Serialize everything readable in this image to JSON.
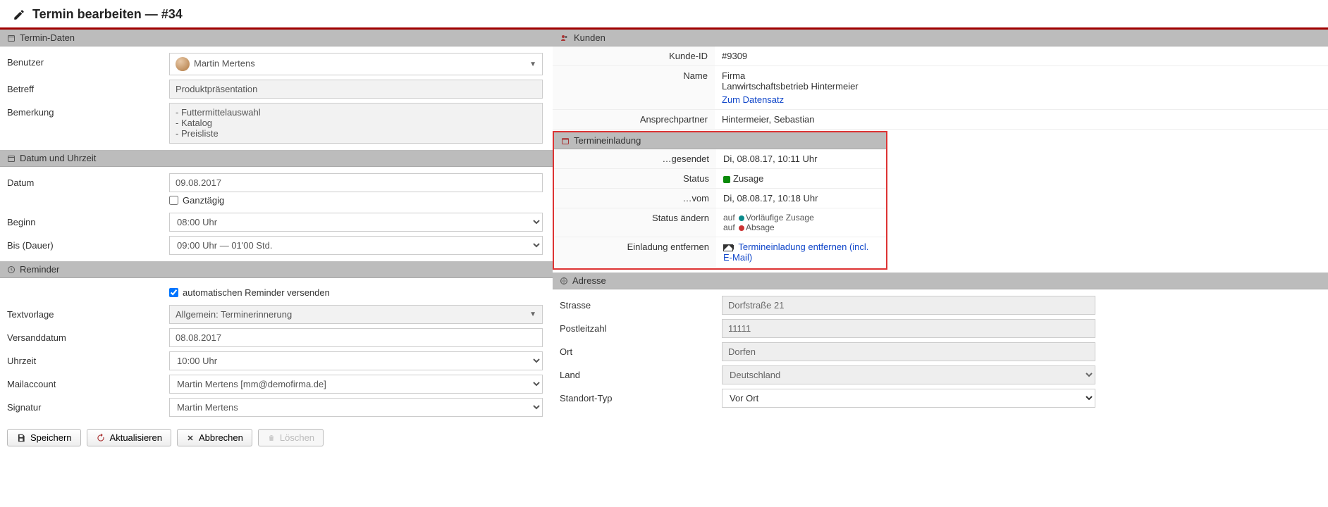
{
  "header": {
    "title": "Termin bearbeiten — #34"
  },
  "sections": {
    "termin_daten": "Termin-Daten",
    "datum_uhrzeit": "Datum und Uhrzeit",
    "reminder": "Reminder",
    "kunden": "Kunden",
    "termineinladung": "Termineinladung",
    "adresse": "Adresse"
  },
  "labels": {
    "benutzer": "Benutzer",
    "betreff": "Betreff",
    "bemerkung": "Bemerkung",
    "datum": "Datum",
    "ganztaegig": "Ganztägig",
    "beginn": "Beginn",
    "bis_dauer": "Bis (Dauer)",
    "auto_reminder": "automatischen Reminder versenden",
    "textvorlage": "Textvorlage",
    "versanddatum": "Versanddatum",
    "uhrzeit": "Uhrzeit",
    "mailaccount": "Mailaccount",
    "signatur": "Signatur",
    "kunde_id": "Kunde-ID",
    "name": "Name",
    "zum_datensatz": "Zum Datensatz",
    "ansprechpartner": "Ansprechpartner",
    "gesendet": "…gesendet",
    "status": "Status",
    "vom": "…vom",
    "status_aendern": "Status ändern",
    "auf_prefix": "auf",
    "vorl_zusage": "Vorläufige Zusage",
    "absage": "Absage",
    "einladung_entfernen": "Einladung entfernen",
    "termineinladung_entfernen": "Termineinladung entfernen (incl. E-Mail)",
    "strasse": "Strasse",
    "plz": "Postleitzahl",
    "ort": "Ort",
    "land": "Land",
    "standort_typ": "Standort-Typ"
  },
  "values": {
    "benutzer": "Martin Mertens",
    "betreff": "Produktpräsentation",
    "bemerkung": "- Futtermittelauswahl\n- Katalog\n- Preisliste",
    "datum": "09.08.2017",
    "ganztaegig_checked": false,
    "beginn": "08:00 Uhr",
    "bis_dauer": "09:00 Uhr — 01'00 Std.",
    "auto_reminder_checked": true,
    "textvorlage": "Allgemein: Terminerinnerung",
    "versanddatum": "08.08.2017",
    "uhrzeit": "10:00 Uhr",
    "mailaccount": "Martin Mertens [mm@demofirma.de]",
    "signatur": "Martin Mertens",
    "kunde_id": "#9309",
    "kunde_name_line1": "Firma",
    "kunde_name_line2": "Lanwirtschaftsbetrieb Hintermeier",
    "ansprechpartner": "Hintermeier, Sebastian",
    "gesendet": "Di, 08.08.17, 10:11 Uhr",
    "status_text": "Zusage",
    "vom": "Di, 08.08.17, 10:18 Uhr",
    "strasse": "Dorfstraße 21",
    "plz": "11111",
    "ort": "Dorfen",
    "land": "Deutschland",
    "standort_typ": "Vor Ort"
  },
  "buttons": {
    "speichern": "Speichern",
    "aktualisieren": "Aktualisieren",
    "abbrechen": "Abbrechen",
    "loeschen": "Löschen"
  }
}
